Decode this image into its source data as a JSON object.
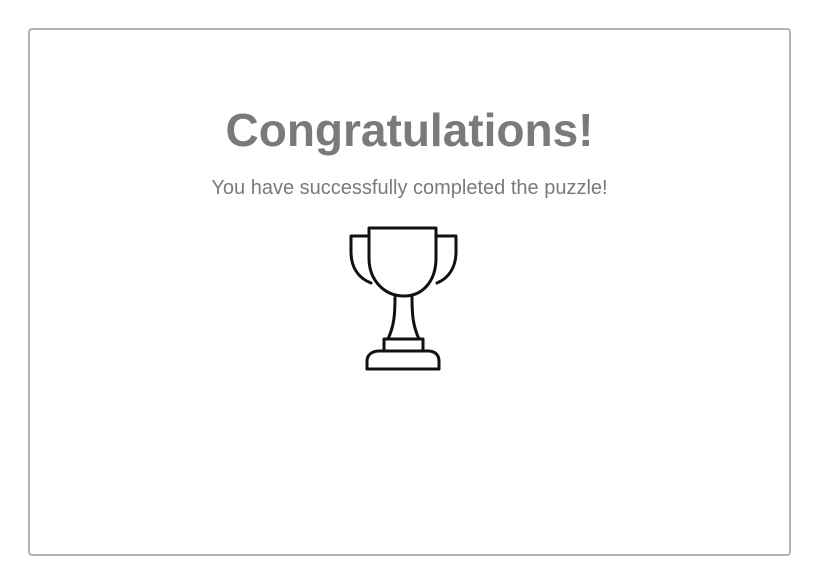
{
  "dialog": {
    "title": "Congratulations!",
    "message": "You have successfully completed the puzzle!",
    "icon": "trophy-icon"
  },
  "colors": {
    "text": "#7a7a7a",
    "border": "#b3b3b3",
    "icon_stroke": "#111111",
    "background": "#ffffff"
  }
}
